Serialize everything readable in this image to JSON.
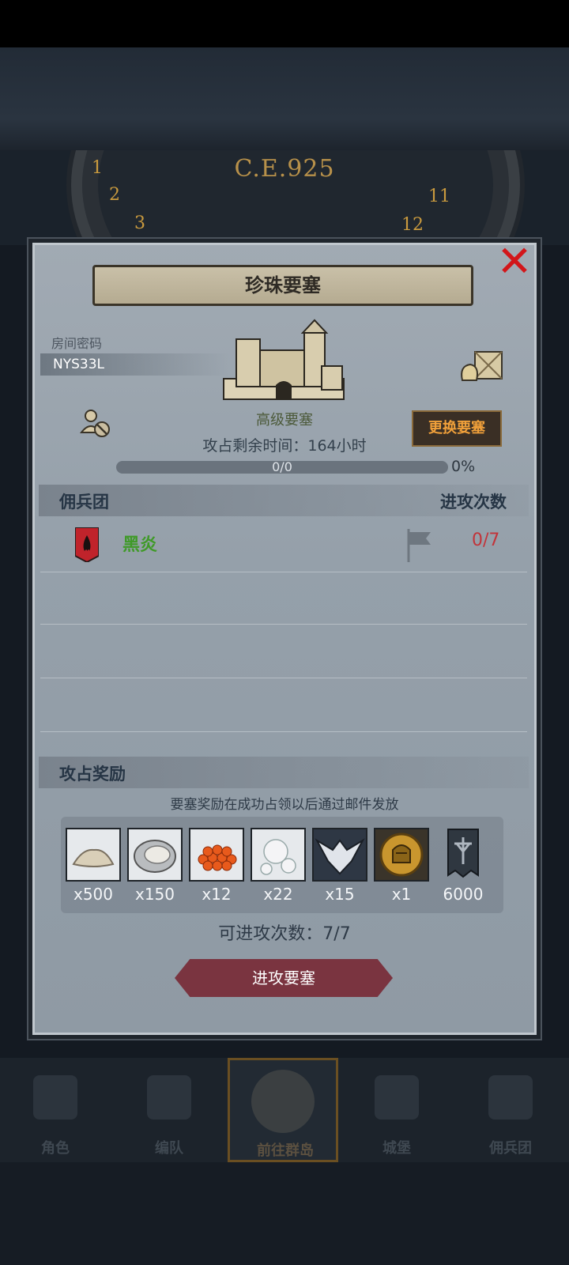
{
  "header": {
    "era": "C.E.925",
    "clock_numbers": [
      "1",
      "2",
      "3",
      "11",
      "12"
    ]
  },
  "dialog": {
    "title": "珍珠要塞",
    "close_icon": "close-x-icon",
    "room_code_label": "房间密码",
    "room_code": "NYS33L",
    "fortress_level": "高级要塞",
    "swap_button": "更换要塞",
    "time_label": "攻占剩余时间：",
    "time_value": "164小时",
    "progress_text": "0/0",
    "progress_fraction": 0,
    "progress_pct": "0%"
  },
  "mercenaries": {
    "header_left": "佣兵团",
    "header_right": "进攻次数",
    "rows": [
      {
        "name": "黑炎",
        "count": "0/7",
        "banner_color": "#c0232b"
      }
    ]
  },
  "rewards": {
    "header": "攻占奖励",
    "note": "要塞奖励在成功占领以后通过邮件发放",
    "items": [
      {
        "icon": "sand-icon",
        "qty": "x500"
      },
      {
        "icon": "oyster-icon",
        "qty": "x150"
      },
      {
        "icon": "roe-icon",
        "qty": "x12"
      },
      {
        "icon": "pearl-icon",
        "qty": "x22"
      },
      {
        "icon": "wing-emblem-icon",
        "qty": "x15"
      },
      {
        "icon": "knight-coin-icon",
        "qty": "x1"
      },
      {
        "icon": "banner-flag-icon",
        "qty": "6000"
      }
    ]
  },
  "attacks_left": "可进攻次数：7/7",
  "attack_button": "进攻要塞",
  "nav": {
    "items": [
      {
        "label": "角色"
      },
      {
        "label": "编队"
      },
      {
        "label": "前往群岛"
      },
      {
        "label": "城堡"
      },
      {
        "label": "佣兵团"
      }
    ],
    "active_index": 2
  },
  "colors": {
    "close_red": "#d2161a",
    "merc_green": "#3f9a28",
    "count_red": "#c2343a",
    "swap_orange": "#f0a03a",
    "attack_button": "#7a3440"
  }
}
